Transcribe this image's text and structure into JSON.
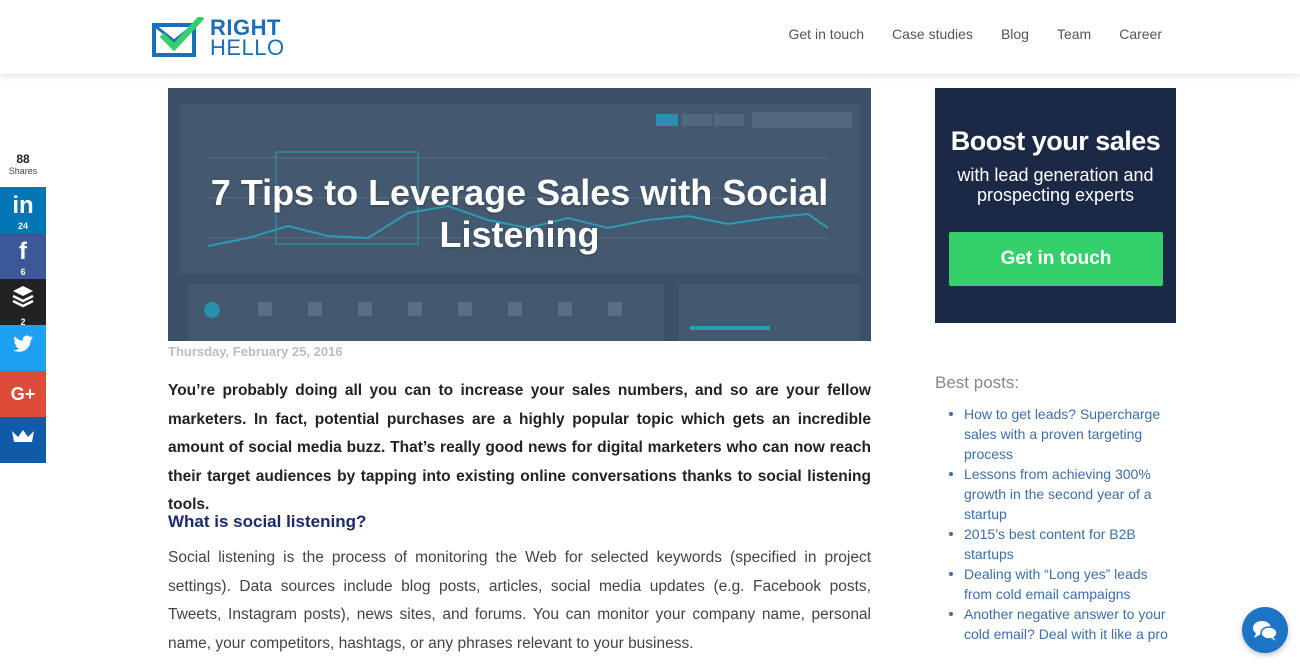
{
  "logo": {
    "line1": "RIGHT",
    "line2": "HELLO"
  },
  "nav": [
    "Get in touch",
    "Case studies",
    "Blog",
    "Team",
    "Career"
  ],
  "share": {
    "total": "88",
    "total_label": "Shares",
    "linkedin": {
      "icon": "linkedin-icon",
      "glyph": "in",
      "count": "24"
    },
    "facebook": {
      "icon": "facebook-icon",
      "glyph": "f",
      "count": "6"
    },
    "buffer": {
      "icon": "buffer-icon",
      "count": "2"
    },
    "twitter": {
      "icon": "twitter-icon"
    },
    "googleplus": {
      "icon": "googleplus-icon",
      "glyph": "G+"
    },
    "sumome": {
      "icon": "crown-icon"
    }
  },
  "article": {
    "title": "7 Tips to Leverage Sales with Social Listening",
    "date": "Thursday, February 25, 2016",
    "intro": "You’re probably doing all you can to increase your sales numbers, and so are your fellow marketers. In fact, potential purchases are a highly popular topic which gets an incredible amount of social media buzz. That’s really good news for digital marketers who can now reach their target audiences by tapping into existing online conversations thanks to social listening tools.",
    "h2": "What is social listening?",
    "para": "Social listening is the process of monitoring the Web for selected keywords (specified in project settings). Data sources include blog posts, articles, social media updates (e.g. Facebook posts, Tweets, Instagram posts), news sites, and forums. You can monitor your company name, personal name, your competitors, hashtags, or any phrases relevant to your business."
  },
  "cta": {
    "title": "Boost your sales",
    "subtitle": "with lead generation and prospecting experts",
    "button": "Get in touch"
  },
  "best_posts": {
    "heading": "Best posts:",
    "items": [
      "How to get leads? Supercharge sales with a proven targeting process",
      "Lessons from achieving 300% growth in the second year of a startup",
      "2015’s best content for B2B startups",
      "Dealing with “Long yes” leads from cold email campaigns",
      "Another negative answer to your cold email? Deal with it like a pro"
    ]
  },
  "colors": {
    "brand": "#1a70b8",
    "cta_bg": "#1b2947",
    "cta_button": "#33d06b",
    "link": "#3c6fa8"
  }
}
